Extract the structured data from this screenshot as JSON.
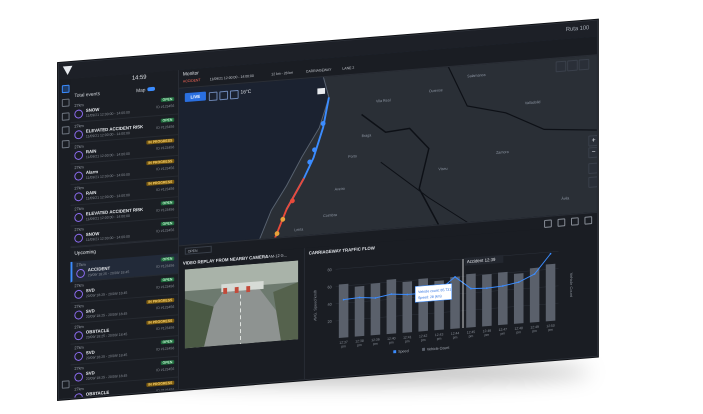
{
  "app": {
    "ruta": "Ruta 100"
  },
  "sidebar": {
    "time": "14:59",
    "total_label": "Total events",
    "total_count": "",
    "map_toggle_label": "Map",
    "alerts": [
      {
        "dist": "27km",
        "title": "SNOW",
        "time": "11/09/21 12:00:00 - 14:00:00",
        "badge": "OPEN",
        "badge_type": "open",
        "id": "ID #123456"
      },
      {
        "dist": "27km",
        "title": "ELEVATED ACCIDENT RISK",
        "time": "11/09/21 12:00:00 - 14:00:00",
        "badge": "OPEN",
        "badge_type": "open",
        "id": "ID #123456"
      },
      {
        "dist": "27km",
        "title": "RAIN",
        "time": "11/09/21 12:00:00 - 14:00:00",
        "badge": "IN PROGRESS",
        "badge_type": "prog",
        "id": "ID #123456"
      },
      {
        "dist": "27km",
        "title": "Alarm",
        "time": "11/09/21 12:00:00 - 14:00:00",
        "badge": "IN PROGRESS",
        "badge_type": "prog",
        "id": "ID #123456"
      },
      {
        "dist": "27km",
        "title": "RAIN",
        "time": "11/09/21 12:00:00 - 14:00:00",
        "badge": "IN PROGRESS",
        "badge_type": "prog",
        "id": "ID #123456"
      },
      {
        "dist": "27km",
        "title": "ELEVATED ACCIDENT RISK",
        "time": "11/09/21 12:00:00 - 14:00:00",
        "badge": "OPEN",
        "badge_type": "open",
        "id": "ID #123456"
      },
      {
        "dist": "27km",
        "title": "SNOW",
        "time": "11/09/21 12:00:00 - 14:00:00",
        "badge": "OPEN",
        "badge_type": "open",
        "id": "ID #123456"
      }
    ],
    "upcoming_label": "Upcoming",
    "upcoming": [
      {
        "dist": "27km",
        "title": "ACCIDENT",
        "time": "20/09/ 18:25 - 20/09/ 18:45",
        "badge": "OPEN",
        "badge_type": "open",
        "id": "ID #123456"
      },
      {
        "dist": "27km",
        "title": "SVD",
        "time": "20/09/ 18:25 - 20/09/ 18:45",
        "badge": "OPEN",
        "badge_type": "open",
        "id": "ID #123456"
      },
      {
        "dist": "27km",
        "title": "SVD",
        "time": "20/09/ 18:25 - 20/09/ 18:45",
        "badge": "IN PROGRESS",
        "badge_type": "prog",
        "id": "ID #123456"
      },
      {
        "dist": "27km",
        "title": "OBSTACLE",
        "time": "20/09/ 18:25 - 20/09/ 18:45",
        "badge": "IN PROGRESS",
        "badge_type": "prog",
        "id": "ID #123456"
      },
      {
        "dist": "27km",
        "title": "SVD",
        "time": "20/09/ 18:25 - 20/09/ 18:45",
        "badge": "OPEN",
        "badge_type": "open",
        "id": "ID #123456"
      },
      {
        "dist": "27km",
        "title": "SVD",
        "time": "20/09/ 18:25 - 20/09/ 18:45",
        "badge": "OPEN",
        "badge_type": "open",
        "id": "ID #123456"
      },
      {
        "dist": "27km",
        "title": "OBSTACLE",
        "time": "20/09/ 18:25 - 20/09/ 18:45",
        "badge": "IN PROGRESS",
        "badge_type": "prog",
        "id": "ID #123456"
      }
    ]
  },
  "monitor": {
    "title": "Monitor",
    "accident_tag": "ACCIDENT",
    "accident_time": "11/09/21 12:00:00 - 14:00:00",
    "km_tag": "12 km - 28 km",
    "carriageway_tag": "CARRIAGEWAY",
    "lane_tag": "LANE 2",
    "live_label": "LIVE",
    "temperature": "16°C",
    "dropdown": "OPEN",
    "places": [
      "Salamanca",
      "Valladolid",
      "Vila Real",
      "Braga",
      "Porto",
      "Aveiro",
      "Coimbra",
      "Viseu",
      "Leiria",
      "Zamora",
      "Ourense",
      "Ávila"
    ]
  },
  "video": {
    "title": "VIDEO REPLAY FROM NEARBY CAMERA",
    "camera": "CAM-12 G..."
  },
  "traffic": {
    "title": "CARRIAGEWAY TRAFFIC FLOW"
  },
  "chart_data": {
    "type": "bar",
    "title": "CARRIAGEWAY TRAFFIC FLOW",
    "ylabel": "AVG. Speed km/h",
    "y2label": "Vehicle Count",
    "categories": [
      "12:37\npm",
      "12:38\npm",
      "12:39\npm",
      "12:40\npm",
      "12:41\npm",
      "12:42\npm",
      "12:43\npm",
      "12:44\npm",
      "12:45\npm",
      "12:46\npm",
      "12:47\npm",
      "12:48\npm",
      "12:49\npm",
      "12:50\npm"
    ],
    "ytick_labels": [
      "20",
      "40",
      "60",
      "80"
    ],
    "ylim": [
      0,
      80
    ],
    "series": [
      {
        "name": "Vehicle Count",
        "type": "bar",
        "values": [
          62,
          58,
          60,
          63,
          59,
          61,
          57,
          60,
          62,
          60,
          61,
          58,
          63,
          66
        ]
      },
      {
        "name": "Speed",
        "type": "line",
        "values": [
          44,
          45,
          43,
          46,
          44,
          44,
          46,
          60,
          45,
          44,
          45,
          48,
          56,
          78
        ]
      }
    ],
    "annotations": [
      {
        "label": "Accident",
        "time": "12:39"
      },
      {
        "label": "Vehicle count: 85.731"
      },
      {
        "label": "Speed: 28 (km)"
      }
    ],
    "legend": [
      "Speed",
      "Vehicle Count"
    ]
  }
}
